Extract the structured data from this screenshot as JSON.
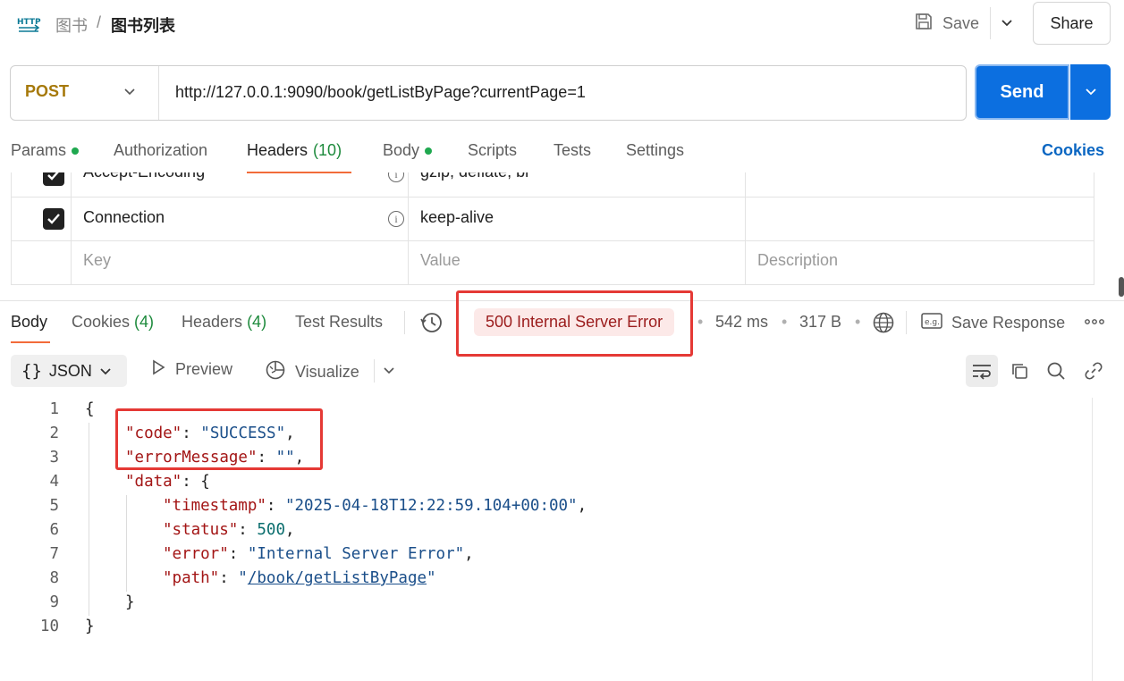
{
  "breadcrumb": {
    "parent": "图书",
    "separator": "/",
    "current": "图书列表"
  },
  "toolbar": {
    "save_label": "Save",
    "share_label": "Share"
  },
  "request": {
    "method": "POST",
    "url": "http://127.0.0.1:9090/book/getListByPage?currentPage=1",
    "send_label": "Send"
  },
  "request_tabs": [
    {
      "label": "Params",
      "dot": true
    },
    {
      "label": "Authorization"
    },
    {
      "label": "Headers",
      "count": "(10)"
    },
    {
      "label": "Body",
      "dot": true
    },
    {
      "label": "Scripts"
    },
    {
      "label": "Tests"
    },
    {
      "label": "Settings"
    }
  ],
  "cookies_link": "Cookies",
  "headers_table": {
    "rows": [
      {
        "key": "Accept-Encoding",
        "value": "gzip, deflate, br"
      },
      {
        "key": "Connection",
        "value": "keep-alive"
      }
    ],
    "placeholders": {
      "key": "Key",
      "value": "Value",
      "description": "Description"
    }
  },
  "response_tabs": [
    {
      "label": "Body"
    },
    {
      "label": "Cookies",
      "count": "(4)"
    },
    {
      "label": "Headers",
      "count": "(4)"
    },
    {
      "label": "Test Results"
    }
  ],
  "response_meta": {
    "status": "500 Internal Server Error",
    "time": "542 ms",
    "size": "317 B",
    "save_response": "Save Response"
  },
  "response_toolbar": {
    "format": "JSON",
    "preview": "Preview",
    "visualize": "Visualize"
  },
  "colors": {
    "accent": "#f26b3a",
    "send": "#0c6fe0",
    "error_bg": "#fce9e8",
    "error_text": "#9b1c1c",
    "highlight": "#e53935"
  },
  "code": {
    "line_numbers": [
      "1",
      "2",
      "3",
      "4",
      "5",
      "6",
      "7",
      "8",
      "9",
      "10"
    ],
    "brace_open": "{",
    "brace_close": "}",
    "code_key": "\"code\"",
    "code_value": "\"SUCCESS\"",
    "error_key": "\"errorMessage\"",
    "error_value": "\"\"",
    "data_key": "\"data\"",
    "timestamp_key": "\"timestamp\"",
    "timestamp_value": "\"2025-04-18T12:22:59.104+00:00\"",
    "status_key": "\"status\"",
    "status_value": "500",
    "error2_key": "\"error\"",
    "error2_value": "\"Internal Server Error\"",
    "path_key": "\"path\"",
    "path_value": "/book/getListByPage"
  }
}
